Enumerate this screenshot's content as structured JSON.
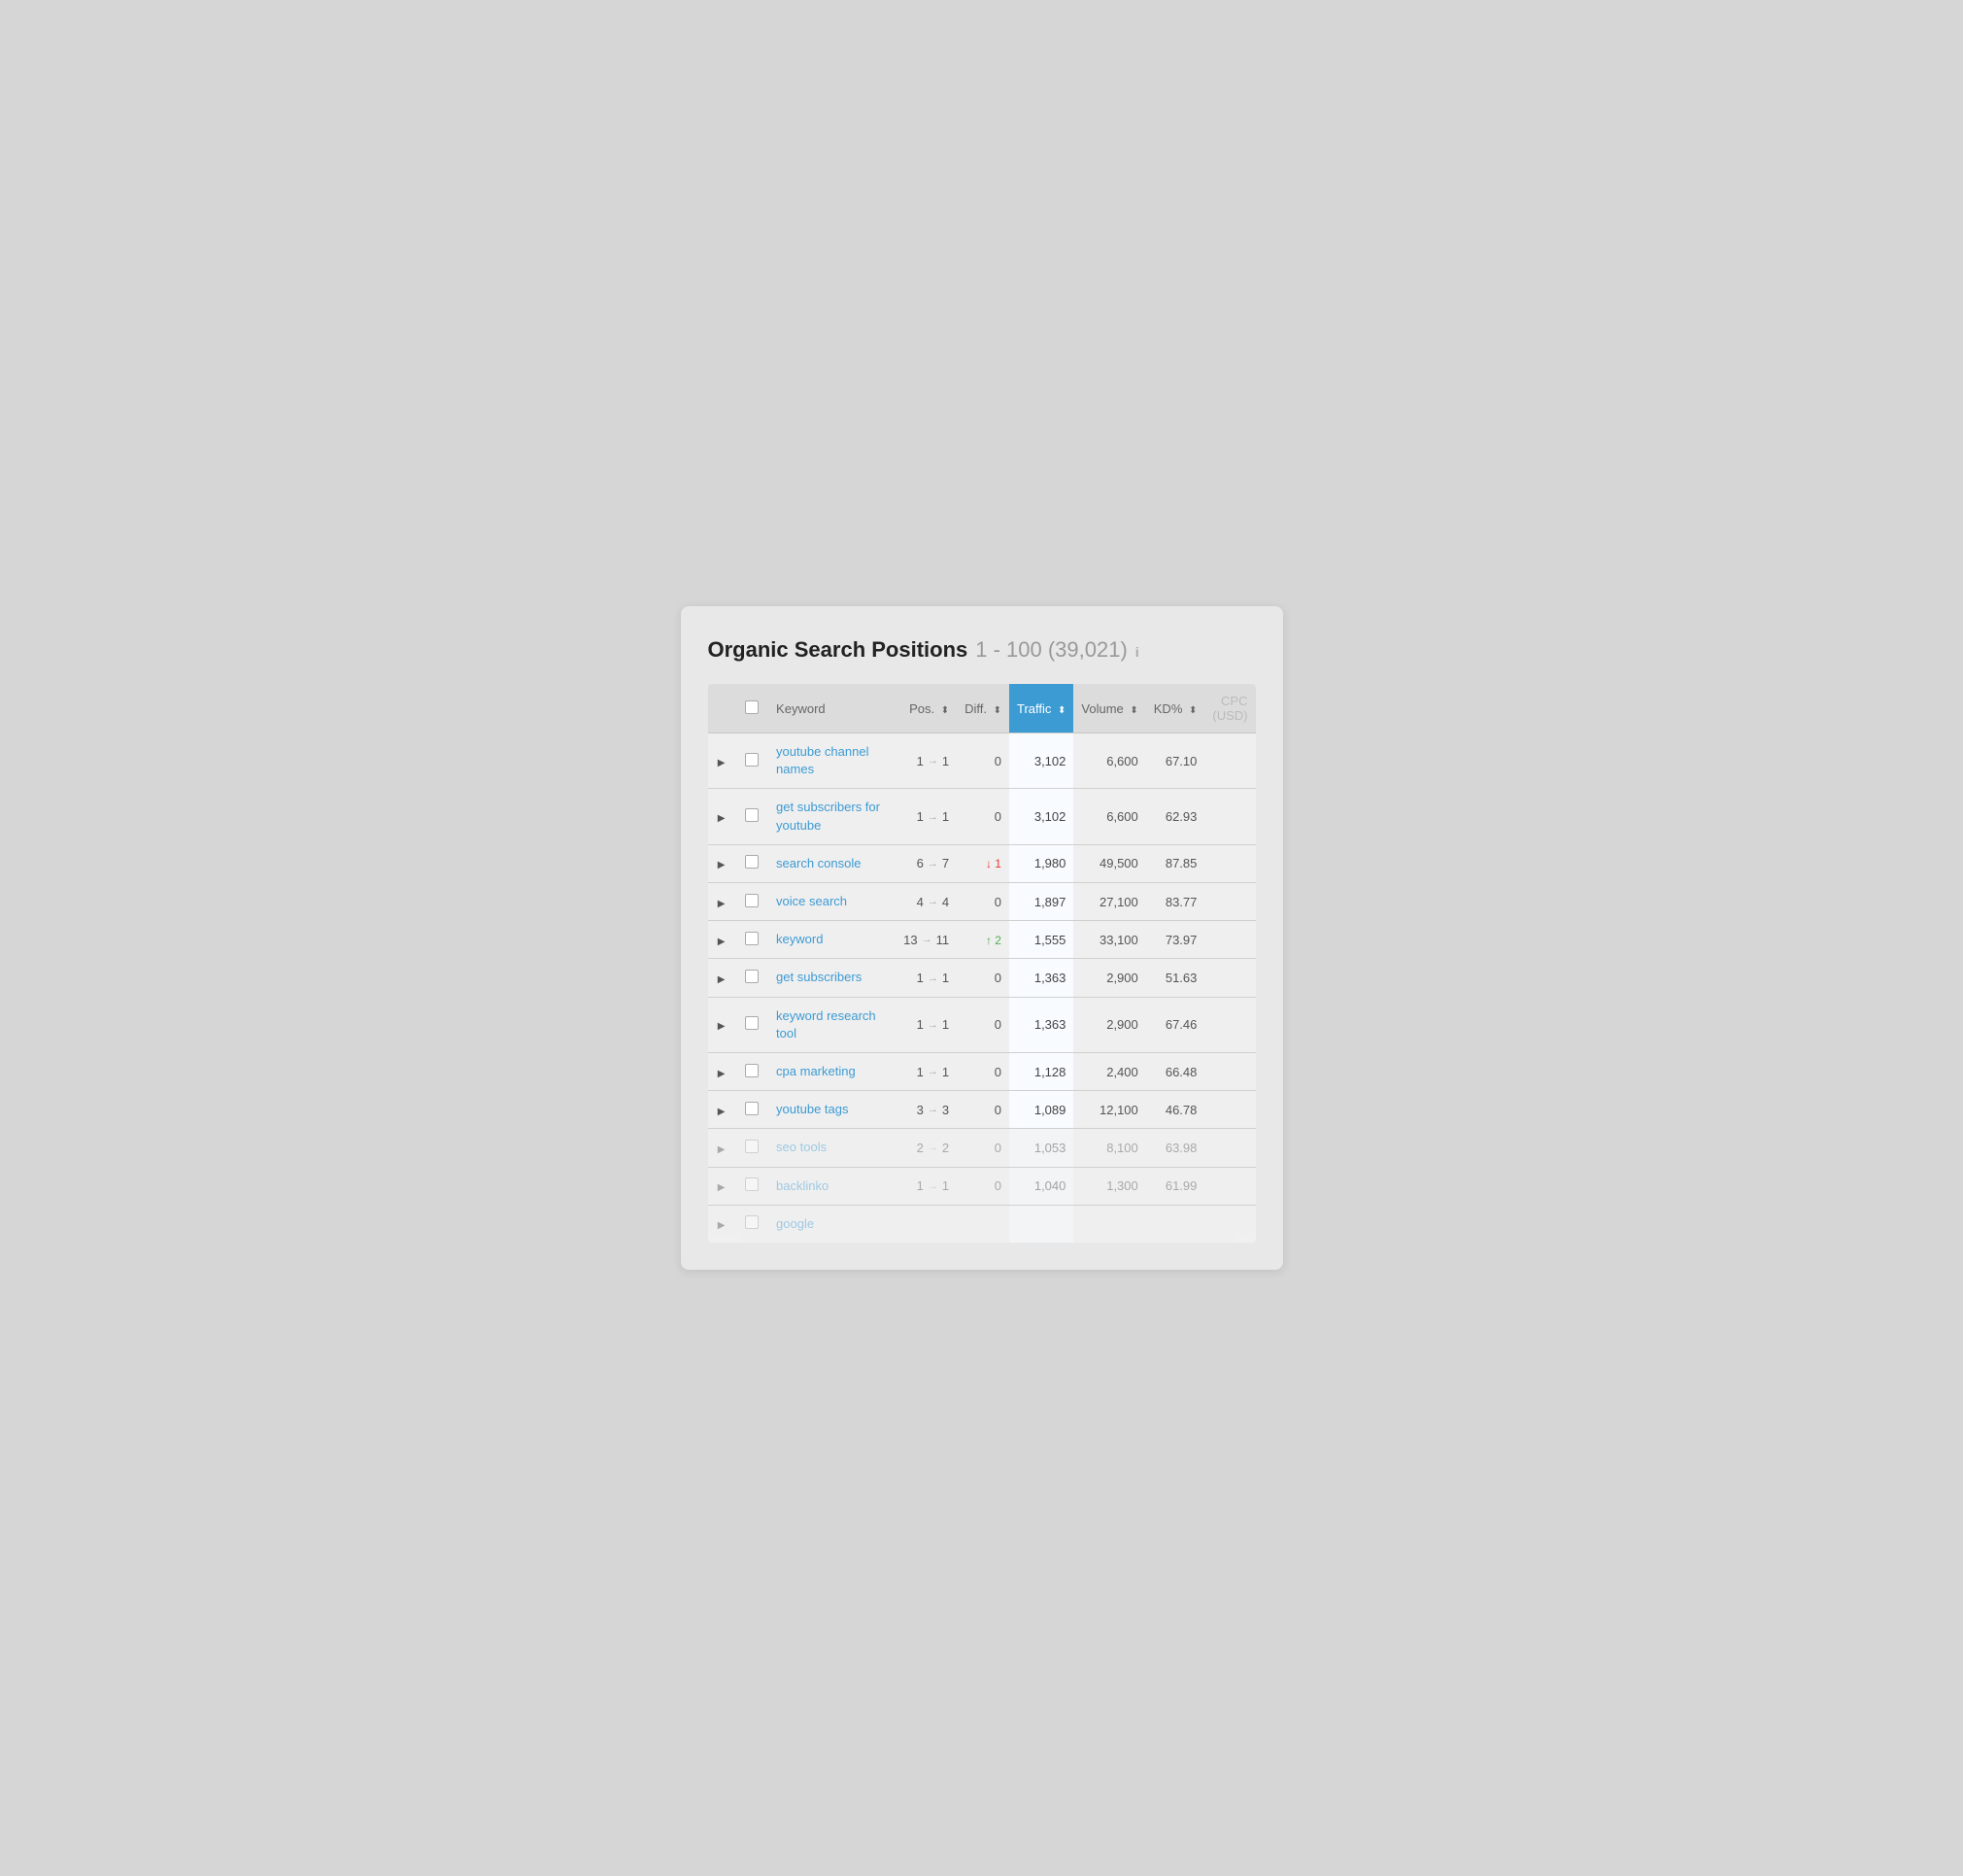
{
  "title": {
    "main": "Organic Search Positions",
    "range": "1 - 100 (39,021)",
    "info": "i"
  },
  "columns": [
    {
      "id": "expand",
      "label": ""
    },
    {
      "id": "checkbox",
      "label": ""
    },
    {
      "id": "keyword",
      "label": "Keyword"
    },
    {
      "id": "pos",
      "label": "Pos."
    },
    {
      "id": "diff",
      "label": "Diff."
    },
    {
      "id": "traffic",
      "label": "Traffic"
    },
    {
      "id": "volume",
      "label": "Volume"
    },
    {
      "id": "kd",
      "label": "KD%"
    },
    {
      "id": "cpc",
      "label": "CPC (USD)"
    }
  ],
  "rows": [
    {
      "keyword": "youtube channel names",
      "pos_from": "1",
      "pos_to": "1",
      "diff_val": "0",
      "diff_type": "zero",
      "traffic": "3,102",
      "volume": "6,600",
      "kd": "67.10",
      "cpc": "",
      "faded": false
    },
    {
      "keyword": "get subscribers for youtube",
      "pos_from": "1",
      "pos_to": "1",
      "diff_val": "0",
      "diff_type": "zero",
      "traffic": "3,102",
      "volume": "6,600",
      "kd": "62.93",
      "cpc": "",
      "faded": false
    },
    {
      "keyword": "search console",
      "pos_from": "6",
      "pos_to": "7",
      "diff_val": "↓ 1",
      "diff_type": "down",
      "traffic": "1,980",
      "volume": "49,500",
      "kd": "87.85",
      "cpc": "",
      "faded": false
    },
    {
      "keyword": "voice search",
      "pos_from": "4",
      "pos_to": "4",
      "diff_val": "0",
      "diff_type": "zero",
      "traffic": "1,897",
      "volume": "27,100",
      "kd": "83.77",
      "cpc": "",
      "faded": false
    },
    {
      "keyword": "keyword",
      "pos_from": "13",
      "pos_to": "11",
      "diff_val": "↑ 2",
      "diff_type": "up",
      "traffic": "1,555",
      "volume": "33,100",
      "kd": "73.97",
      "cpc": "",
      "faded": false
    },
    {
      "keyword": "get subscribers",
      "pos_from": "1",
      "pos_to": "1",
      "diff_val": "0",
      "diff_type": "zero",
      "traffic": "1,363",
      "volume": "2,900",
      "kd": "51.63",
      "cpc": "",
      "faded": false
    },
    {
      "keyword": "keyword research tool",
      "pos_from": "1",
      "pos_to": "1",
      "diff_val": "0",
      "diff_type": "zero",
      "traffic": "1,363",
      "volume": "2,900",
      "kd": "67.46",
      "cpc": "",
      "faded": false
    },
    {
      "keyword": "cpa marketing",
      "pos_from": "1",
      "pos_to": "1",
      "diff_val": "0",
      "diff_type": "zero",
      "traffic": "1,128",
      "volume": "2,400",
      "kd": "66.48",
      "cpc": "",
      "faded": false
    },
    {
      "keyword": "youtube tags",
      "pos_from": "3",
      "pos_to": "3",
      "diff_val": "0",
      "diff_type": "zero",
      "traffic": "1,089",
      "volume": "12,100",
      "kd": "46.78",
      "cpc": "",
      "faded": false
    },
    {
      "keyword": "seo tools",
      "pos_from": "2",
      "pos_to": "2",
      "diff_val": "0",
      "diff_type": "zero",
      "traffic": "1,053",
      "volume": "8,100",
      "kd": "63.98",
      "cpc": "",
      "faded": true
    },
    {
      "keyword": "backlinko",
      "pos_from": "1",
      "pos_to": "1",
      "diff_val": "0",
      "diff_type": "zero",
      "traffic": "1,040",
      "volume": "1,300",
      "kd": "61.99",
      "cpc": "",
      "faded": true
    },
    {
      "keyword": "google",
      "pos_from": "",
      "pos_to": "",
      "diff_val": "",
      "diff_type": "zero",
      "traffic": "",
      "volume": "",
      "kd": "",
      "cpc": "",
      "faded": true
    }
  ]
}
